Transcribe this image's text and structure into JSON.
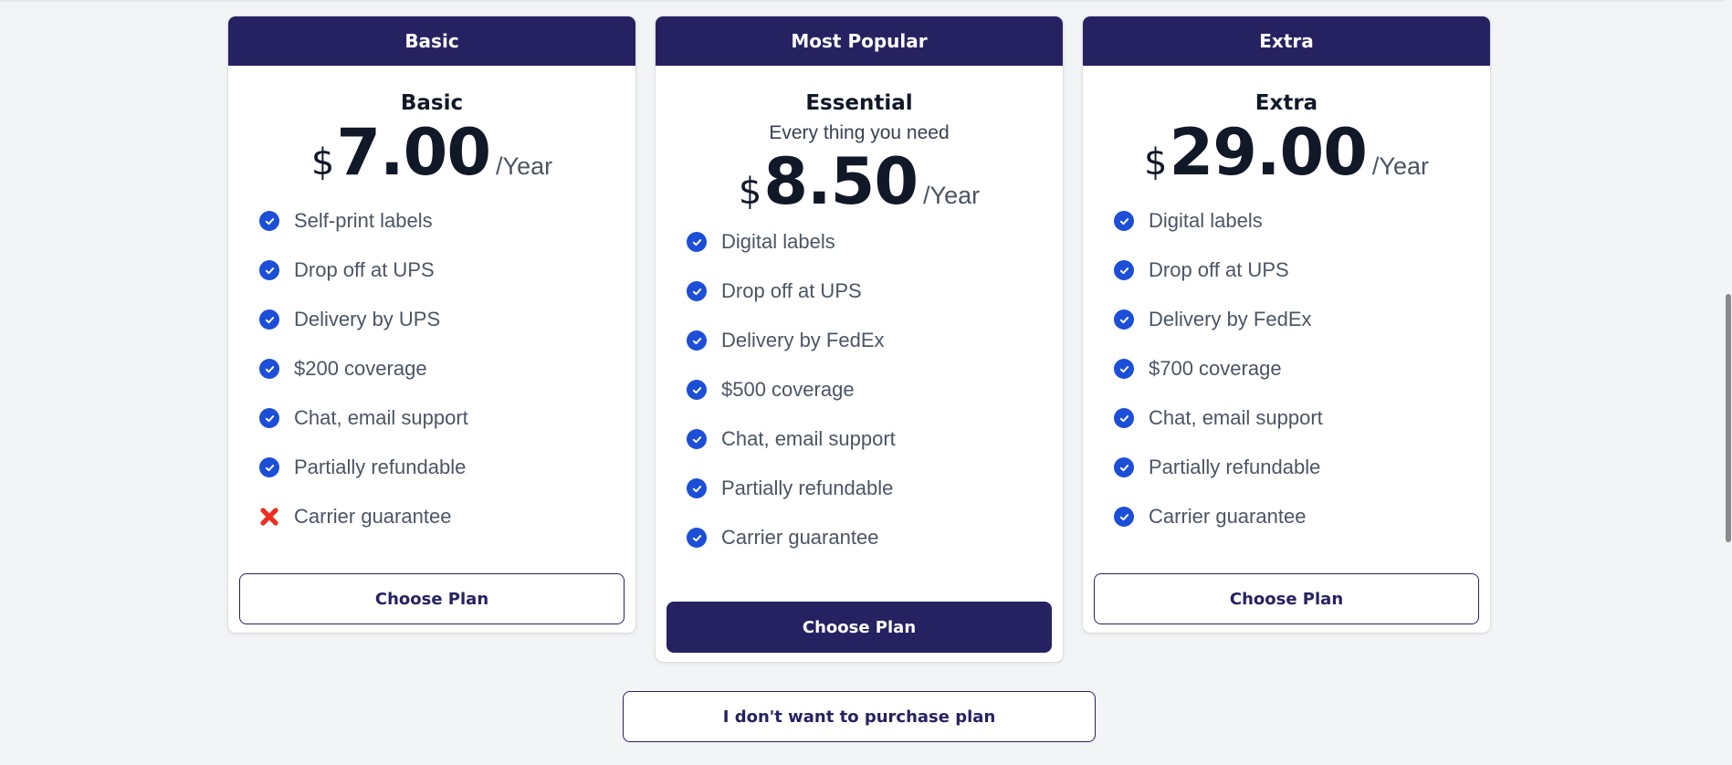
{
  "plans": [
    {
      "header": "Basic",
      "name": "Basic",
      "subtitle": "",
      "currency": "$",
      "price": "7.00",
      "period": "/Year",
      "features": [
        {
          "label": "Self-print labels",
          "included": true
        },
        {
          "label": "Drop off at UPS",
          "included": true
        },
        {
          "label": "Delivery by UPS",
          "included": true
        },
        {
          "label": "$200 coverage",
          "included": true
        },
        {
          "label": "Chat, email support",
          "included": true
        },
        {
          "label": "Partially refundable",
          "included": true
        },
        {
          "label": "Carrier guarantee",
          "included": false
        }
      ],
      "button_label": "Choose Plan"
    },
    {
      "header": "Most Popular",
      "name": "Essential",
      "subtitle": "Every thing you need",
      "currency": "$",
      "price": "8.50",
      "period": "/Year",
      "features": [
        {
          "label": "Digital labels",
          "included": true
        },
        {
          "label": "Drop off at UPS",
          "included": true
        },
        {
          "label": "Delivery by FedEx",
          "included": true
        },
        {
          "label": "$500 coverage",
          "included": true
        },
        {
          "label": "Chat, email support",
          "included": true
        },
        {
          "label": "Partially refundable",
          "included": true
        },
        {
          "label": "Carrier guarantee",
          "included": true
        }
      ],
      "button_label": "Choose Plan"
    },
    {
      "header": "Extra",
      "name": "Extra",
      "subtitle": "",
      "currency": "$",
      "price": "29.00",
      "period": "/Year",
      "features": [
        {
          "label": "Digital labels",
          "included": true
        },
        {
          "label": "Drop off at UPS",
          "included": true
        },
        {
          "label": "Delivery by FedEx",
          "included": true
        },
        {
          "label": "$700 coverage",
          "included": true
        },
        {
          "label": "Chat, email support",
          "included": true
        },
        {
          "label": "Partially refundable",
          "included": true
        },
        {
          "label": "Carrier guarantee",
          "included": true
        }
      ],
      "button_label": "Choose Plan"
    }
  ],
  "skip_label": "I don't want to purchase plan",
  "colors": {
    "brand": "#262262",
    "check": "#1d4ed8",
    "cross": "#ef2b1f",
    "background": "#f3f4f6"
  },
  "icons": {
    "included": "check-circle-icon",
    "excluded": "cross-icon"
  }
}
